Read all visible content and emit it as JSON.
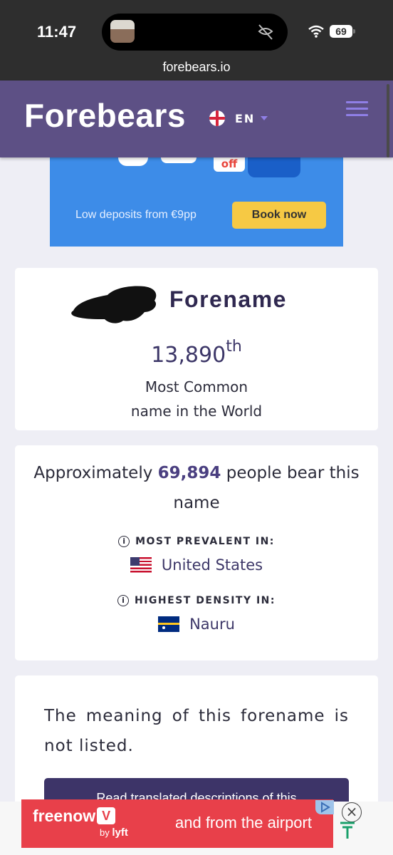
{
  "status_bar": {
    "time": "11:47",
    "battery": "69",
    "url": "forebears.io"
  },
  "header": {
    "logo": "Forebears",
    "language": "EN"
  },
  "ad": {
    "badge": "off",
    "text": "Low deposits from €9pp",
    "cta": "Book now"
  },
  "rank_card": {
    "name_type": "Forename",
    "rank": "13,890",
    "rank_suffix": "th",
    "caption_line1": "Most Common",
    "caption_line2": "name in the World"
  },
  "count_card": {
    "prefix": "Approximately",
    "count": "69,894",
    "suffix": "people bear this name",
    "prevalent_label": "MOST PREVALENT IN:",
    "prevalent_country": "United States",
    "density_label": "HIGHEST DENSITY IN:",
    "density_country": "Nauru"
  },
  "meaning_card": {
    "text": "The meaning of this forename is not listed.",
    "button": "Read translated descriptions of this"
  },
  "bottom_ad": {
    "brand": "freenow",
    "brand_mark": "V",
    "by": "by",
    "partner": "lyft",
    "text": "and from the airport",
    "close": "×"
  },
  "icons": {
    "info": "i"
  },
  "colors": {
    "header": "#5d5085",
    "accent": "#8f7fe6",
    "ad_blue": "#3d8ce8",
    "ad_cta": "#f6c944",
    "bottom_ad": "#e8404a",
    "text_dark": "#2b2b3a"
  }
}
